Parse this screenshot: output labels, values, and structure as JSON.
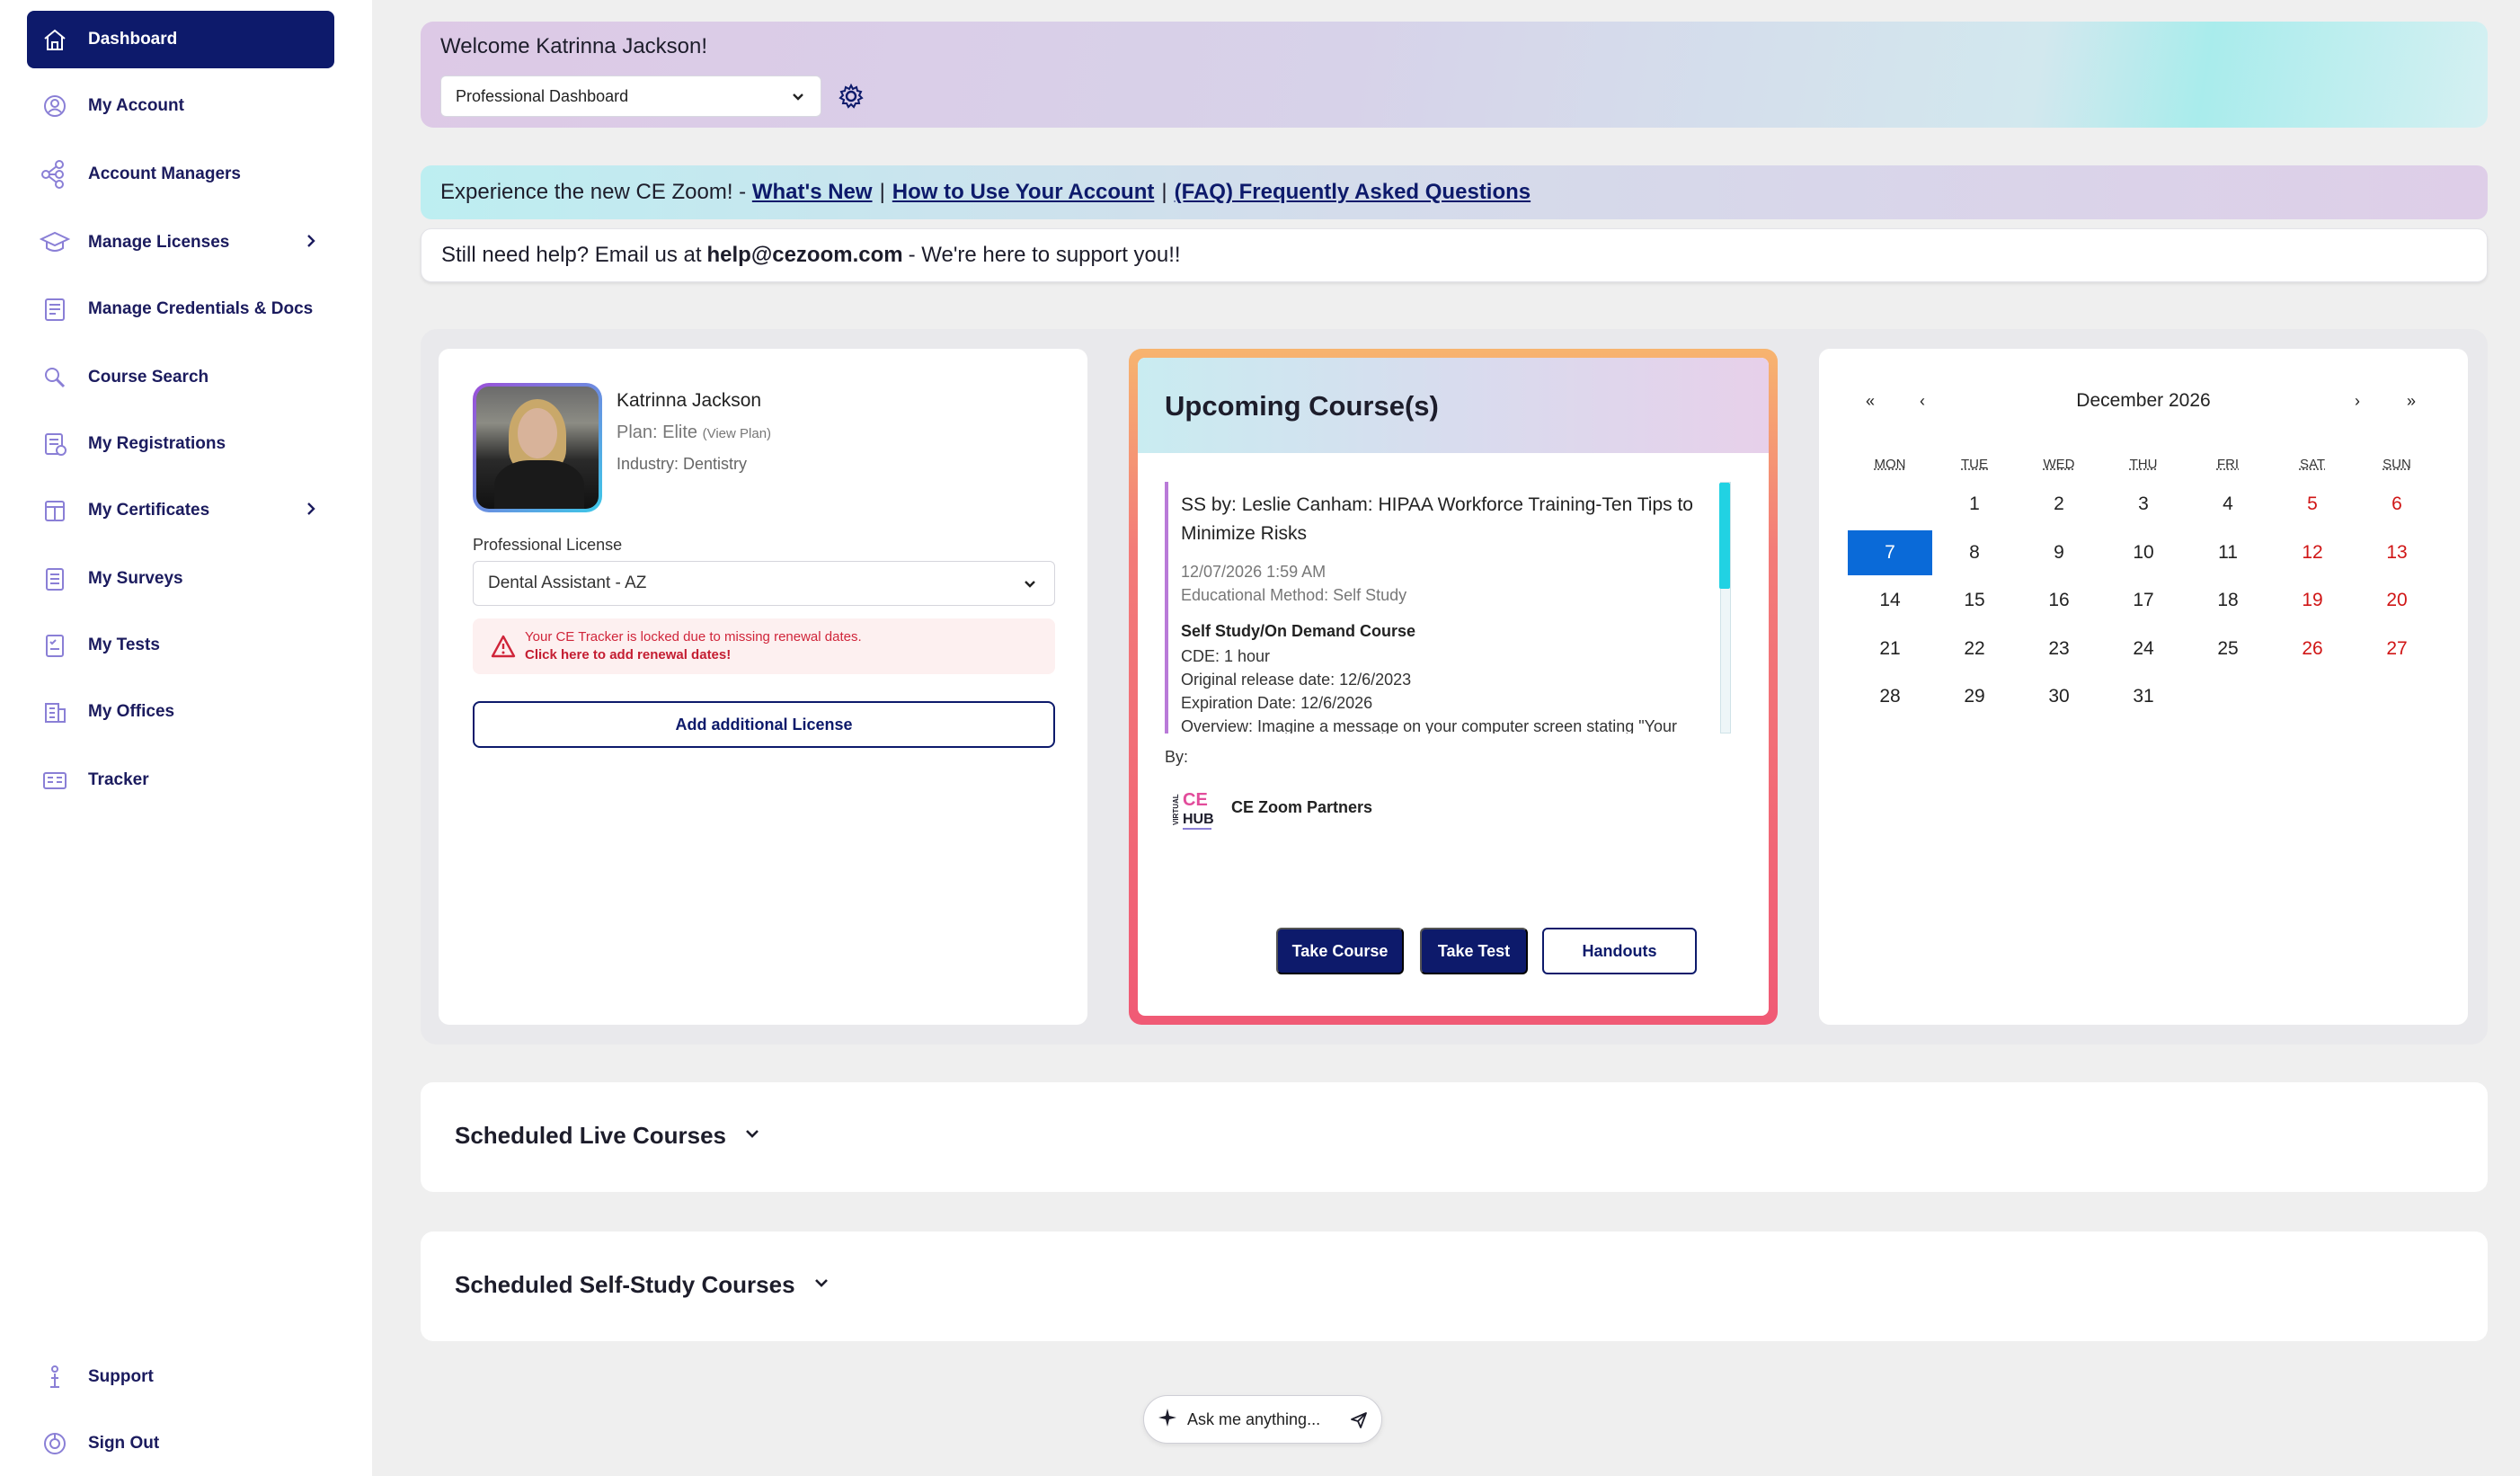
{
  "sidebar": {
    "items": [
      {
        "label": "Dashboard",
        "icon": "home-icon"
      },
      {
        "label": "My Account",
        "icon": "account-icon"
      },
      {
        "label": "Account Managers",
        "icon": "network-icon"
      },
      {
        "label": "Manage Licenses",
        "icon": "graduation-cap-icon"
      },
      {
        "label": "Manage Credentials & Docs",
        "icon": "credentials-icon"
      },
      {
        "label": "Course Search",
        "icon": "search-icon"
      },
      {
        "label": "My Registrations",
        "icon": "registrations-icon"
      },
      {
        "label": "My Certificates",
        "icon": "certificate-icon"
      },
      {
        "label": "My Surveys",
        "icon": "survey-icon"
      },
      {
        "label": "My Tests",
        "icon": "test-icon"
      },
      {
        "label": "My Offices",
        "icon": "office-icon"
      },
      {
        "label": "Tracker",
        "icon": "tracker-icon"
      }
    ],
    "support": "Support",
    "signout": "Sign Out"
  },
  "header": {
    "welcome": "Welcome Katrinna Jackson!",
    "dashboard_select": "Professional Dashboard"
  },
  "banner": {
    "prefix": "Experience the new CE Zoom! -",
    "link1": "What's New",
    "link2": "How to Use Your Account",
    "link3": "(FAQ) Frequently Asked Questions"
  },
  "help": {
    "prefix": "Still need help? Email us at",
    "email": "help@cezoom.com",
    "suffix": "- We're here to support you!!"
  },
  "profile": {
    "name": "Katrinna Jackson",
    "plan_prefix": "Plan: Elite",
    "plan_link": "(View Plan)",
    "industry": "Industry: Dentistry",
    "license_label": "Professional License",
    "license_value": "Dental Assistant - AZ",
    "alert_text": "Your CE Tracker is locked due to missing renewal dates.",
    "alert_link": "Click here to add renewal dates!",
    "add_license": "Add additional License"
  },
  "upcoming": {
    "title": "Upcoming Course(s)",
    "course_title": "SS by: Leslie Canham: HIPAA Workforce Training-Ten Tips to Minimize Risks",
    "date": "12/07/2026 1:59 AM",
    "method": "Educational Method: Self Study",
    "type": "Self Study/On Demand Course",
    "cde": "CDE: 1 hour",
    "original_release": "Original release date: 12/6/2023",
    "expiration": "Expiration Date: 12/6/2026",
    "overview": "Overview: Imagine a message on your computer screen stating \"Your",
    "by_label": "By:",
    "partner": "CE Zoom Partners",
    "take_course": "Take Course",
    "take_test": "Take Test",
    "handouts": "Handouts"
  },
  "calendar": {
    "month": "December 2026",
    "nav": {
      "first": "«",
      "prev": "‹",
      "next": "›",
      "last": "»"
    },
    "days_of_week": [
      "MON",
      "TUE",
      "WED",
      "THU",
      "FRI",
      "SAT",
      "SUN"
    ],
    "weeks": [
      [
        "",
        "1",
        "2",
        "3",
        "4",
        "5",
        "6"
      ],
      [
        "7",
        "8",
        "9",
        "10",
        "11",
        "12",
        "13"
      ],
      [
        "14",
        "15",
        "16",
        "17",
        "18",
        "19",
        "20"
      ],
      [
        "21",
        "22",
        "23",
        "24",
        "25",
        "26",
        "27"
      ],
      [
        "28",
        "29",
        "30",
        "31",
        "",
        "",
        ""
      ]
    ],
    "selected": "7",
    "weekend_color": "#d01616",
    "selected_color": "#0a6ad8"
  },
  "sections": {
    "live": "Scheduled Live Courses",
    "self_study": "Scheduled Self-Study Courses"
  },
  "ask": {
    "placeholder": "Ask me anything..."
  },
  "colors": {
    "primary": "#0d1a6b",
    "alert": "#d0253a"
  }
}
